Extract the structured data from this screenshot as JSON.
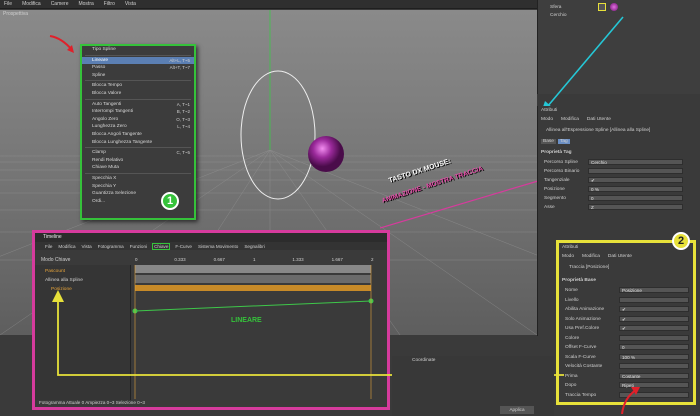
{
  "menubar": {
    "items": [
      "File",
      "Modifica",
      "Camere",
      "Mostra",
      "Filtro",
      "Vista"
    ]
  },
  "viewport": {
    "label": "Prospettiva"
  },
  "context_menu": {
    "items": [
      {
        "label": "Tipo Spline",
        "shortcut": ""
      },
      {
        "label": "Lineare",
        "shortcut": "Alt+L, T~5",
        "selected": true
      },
      {
        "label": "Passo",
        "shortcut": "Alt+T, T~7"
      },
      {
        "label": "Spline",
        "shortcut": ""
      },
      {
        "label": "Blocca Tempo",
        "shortcut": ""
      },
      {
        "label": "Blocca Valore",
        "shortcut": ""
      },
      {
        "label": "Auto Tangenti",
        "shortcut": "A, T~1"
      },
      {
        "label": "Interrompi Tangenti",
        "shortcut": "B, T~2"
      },
      {
        "label": "Angolo Zero",
        "shortcut": "O, T~3"
      },
      {
        "label": "Lunghezza Zero",
        "shortcut": "L, T~4"
      },
      {
        "label": "Blocca Angoli Tangente",
        "shortcut": ""
      },
      {
        "label": "Blocca Lunghezza Tangente",
        "shortcut": ""
      },
      {
        "label": "Clamp",
        "shortcut": "C, T~5"
      },
      {
        "label": "Rendi Relativo",
        "shortcut": ""
      },
      {
        "label": "Chiave Muta",
        "shortcut": ""
      },
      {
        "label": "Specchia X",
        "shortcut": ""
      },
      {
        "label": "Specchia Y",
        "shortcut": ""
      },
      {
        "label": "Guantizza Selezione",
        "shortcut": ""
      },
      {
        "label": "Ordi...",
        "shortcut": ""
      }
    ]
  },
  "object_manager": {
    "objects": [
      "Sfera",
      "Cerchio"
    ]
  },
  "attr_panel": {
    "title": "Attributi",
    "menu": [
      "Modo",
      "Modifica",
      "Dati Utente"
    ],
    "header": "Allinea all'Espressione Spline [Allinea alla Spline]",
    "tabs": [
      "Base",
      "Tag"
    ],
    "section": "Proprietà Tag",
    "fields": [
      {
        "label": "Percorso Spline",
        "value": "Cerchio"
      },
      {
        "label": "Percorso Binario",
        "value": ""
      },
      {
        "label": "Tangenziale",
        "value": "✔"
      },
      {
        "label": "Posizione",
        "value": "0 %"
      },
      {
        "label": "Segmento",
        "value": "0"
      },
      {
        "label": "Asse",
        "value": "Z"
      }
    ]
  },
  "annotation": {
    "line1": "TASTO DX MOUSE:",
    "line2": "ANIMAZIONE - MOSTRA TRACCIA",
    "lineare": "LINEARE",
    "badge1": "1",
    "badge2": "2"
  },
  "timeline": {
    "title": "Timeline",
    "menu": [
      "File",
      "Modifica",
      "Vista",
      "Fotogramma",
      "Funzioni",
      "Chiave",
      "F-Curve",
      "Sistema Movimento",
      "Segnalibri"
    ],
    "highlight_menu": "Chiave",
    "mode_label": "Modo Chiave",
    "tracks": [
      "Pascount",
      "Allinea alla Spline",
      "Posizione"
    ],
    "ruler": [
      "0",
      "0.333",
      "0.667",
      "1",
      "1.333",
      "1.667",
      "2"
    ],
    "status": "Fotogramma Attuale  0  Ampiezza  0~3  Selezione  0~3"
  },
  "attr2": {
    "title": "Attributi",
    "menu": [
      "Modo",
      "Modifica",
      "Dati Utente"
    ],
    "header": "Traccia [Posizione]",
    "section": "Proprietà Base",
    "fields": [
      {
        "label": "Nome",
        "value": "Posizione"
      },
      {
        "label": "Livello",
        "value": ""
      },
      {
        "label": "Abilita Animazione",
        "value": "✔"
      },
      {
        "label": "Solo Animazione",
        "value": "✔"
      },
      {
        "label": "Usa Pref.Colore",
        "value": "✔"
      },
      {
        "label": "Colore",
        "value": ""
      },
      {
        "label": "Offset F-Curve",
        "value": "0"
      },
      {
        "label": "Scala F-Curve",
        "value": "100 %"
      },
      {
        "label": "Velocità Costante",
        "value": ""
      },
      {
        "label": "Prima",
        "value": "Costante"
      },
      {
        "label": "Dopo",
        "value": "Ripeti"
      },
      {
        "label": "Traccia Tempo",
        "value": ""
      }
    ]
  },
  "coords": {
    "title": "Coordinate",
    "apply": "Applica"
  }
}
